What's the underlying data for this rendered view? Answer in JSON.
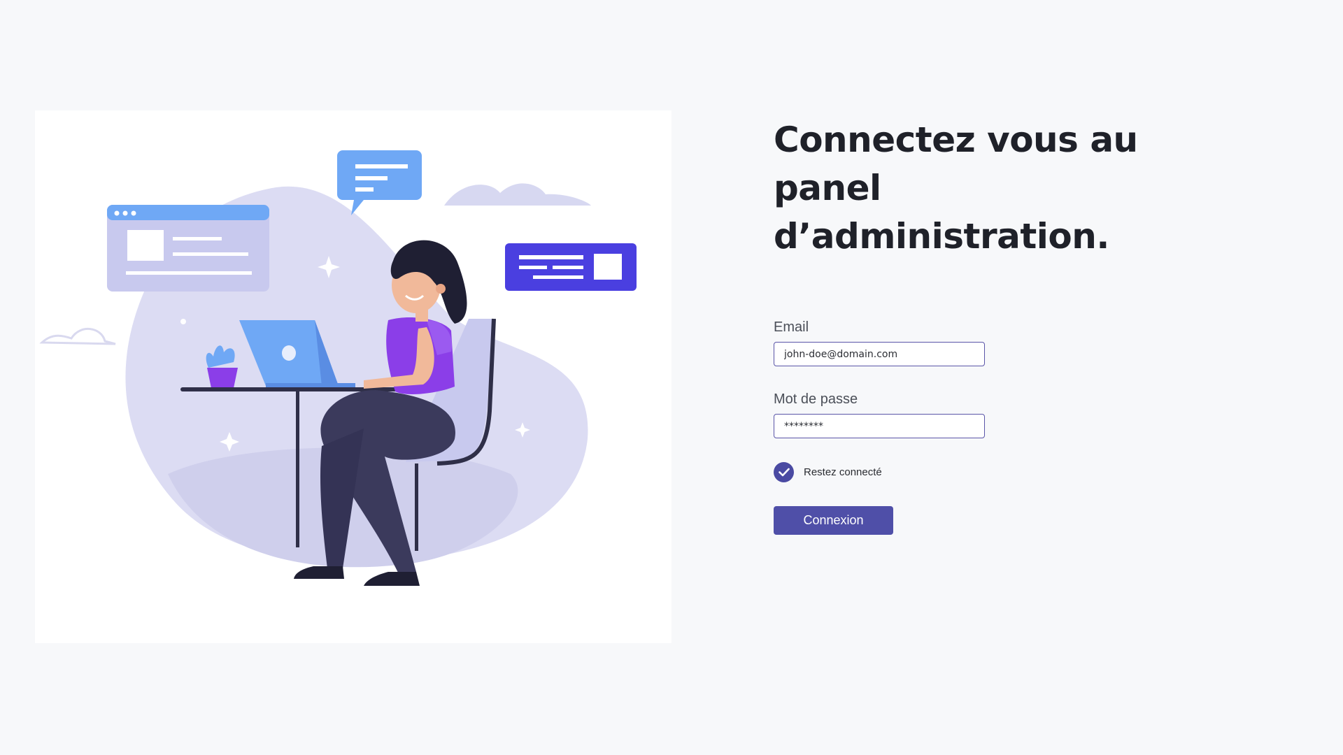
{
  "title": {
    "line1": "Connectez vous au panel",
    "line2": "d’administration."
  },
  "form": {
    "email_label": "Email",
    "email_value": "john-doe@domain.com",
    "password_label": "Mot de passe",
    "password_value": "********",
    "remember_label": "Restez connecté",
    "remember_checked": true,
    "submit_label": "Connexion"
  },
  "illustration": {
    "icon": "woman-at-laptop-illustration"
  },
  "colors": {
    "background": "#f7f8fa",
    "accent": "#4f4fa8",
    "title": "#1f2129",
    "input_border": "#5a55a8"
  }
}
